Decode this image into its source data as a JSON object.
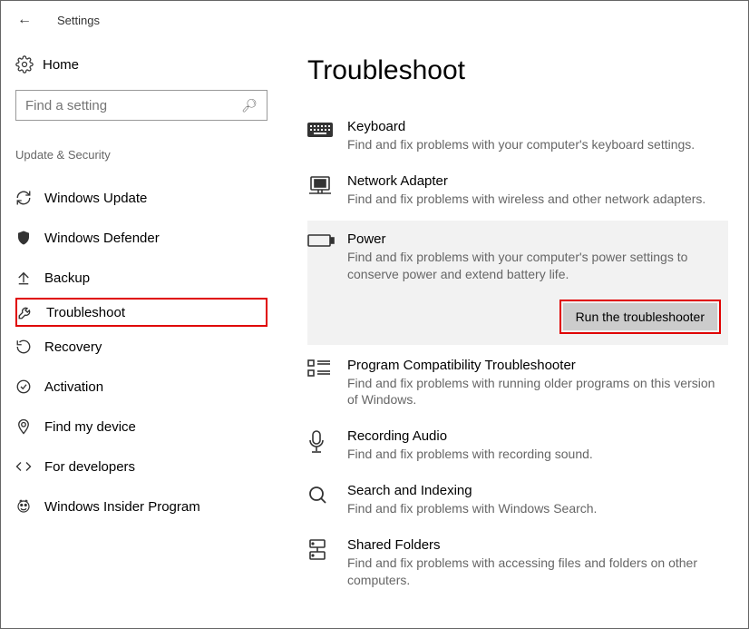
{
  "titlebar": {
    "title": "Settings"
  },
  "sidebar": {
    "home_label": "Home",
    "search_placeholder": "Find a setting",
    "section_title": "Update & Security",
    "items": [
      {
        "label": "Windows Update"
      },
      {
        "label": "Windows Defender"
      },
      {
        "label": "Backup"
      },
      {
        "label": "Troubleshoot"
      },
      {
        "label": "Recovery"
      },
      {
        "label": "Activation"
      },
      {
        "label": "Find my device"
      },
      {
        "label": "For developers"
      },
      {
        "label": "Windows Insider Program"
      }
    ]
  },
  "main": {
    "title": "Troubleshoot",
    "items": [
      {
        "title": "Keyboard",
        "desc": "Find and fix problems with your computer's keyboard settings."
      },
      {
        "title": "Network Adapter",
        "desc": "Find and fix problems with wireless and other network adapters."
      },
      {
        "title": "Power",
        "desc": "Find and fix problems with your computer's power settings to conserve power and extend battery life."
      },
      {
        "title": "Program Compatibility Troubleshooter",
        "desc": "Find and fix problems with running older programs on this version of Windows."
      },
      {
        "title": "Recording Audio",
        "desc": "Find and fix problems with recording sound."
      },
      {
        "title": "Search and Indexing",
        "desc": "Find and fix problems with Windows Search."
      },
      {
        "title": "Shared Folders",
        "desc": "Find and fix problems with accessing files and folders on other computers."
      }
    ],
    "run_label": "Run the troubleshooter"
  }
}
